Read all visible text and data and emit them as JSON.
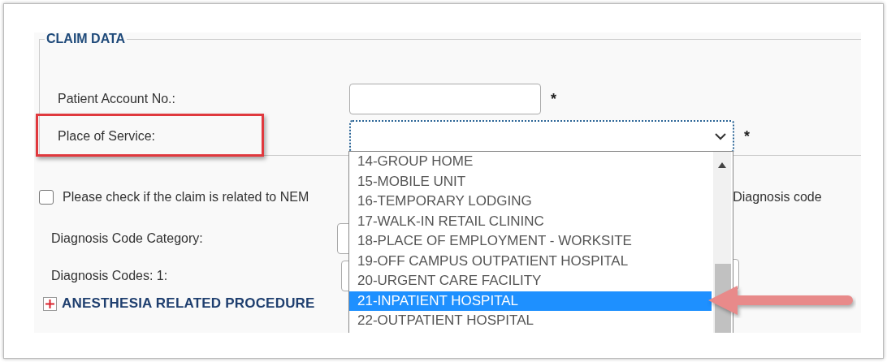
{
  "section": {
    "legend": "CLAIM DATA"
  },
  "fields": [
    {
      "label": "Patient Account No.:",
      "required_mark": "*",
      "kind": "text",
      "highlighted": false
    },
    {
      "label": "Place of Service:",
      "required_mark": "*",
      "kind": "select",
      "highlighted": true
    }
  ],
  "dropdown": {
    "options": [
      {
        "label": "14-GROUP HOME",
        "selected": false
      },
      {
        "label": "15-MOBILE UNIT",
        "selected": false
      },
      {
        "label": "16-TEMPORARY LODGING",
        "selected": false
      },
      {
        "label": "17-WALK-IN RETAIL CLININC",
        "selected": false
      },
      {
        "label": "18-PLACE OF EMPLOYMENT - WORKSITE",
        "selected": false
      },
      {
        "label": "19-OFF CAMPUS OUTPATIENT HOSPITAL",
        "selected": false
      },
      {
        "label": "20-URGENT CARE FACILITY",
        "selected": false
      },
      {
        "label": "21-INPATIENT HOSPITAL",
        "selected": true
      },
      {
        "label": "22-OUTPATIENT HOSPITAL",
        "selected": false
      }
    ]
  },
  "nemt": {
    "checked": false,
    "text": "Please check if the claim is related to NEM",
    "text_right": "Diagnosis code"
  },
  "diagnosis": [
    {
      "label": "Diagnosis Code Category:"
    },
    {
      "label": "Diagnosis Codes: 1:"
    }
  ],
  "anesthesia": {
    "label": "ANESTHESIA RELATED PROCEDURE",
    "expanded": false
  }
}
